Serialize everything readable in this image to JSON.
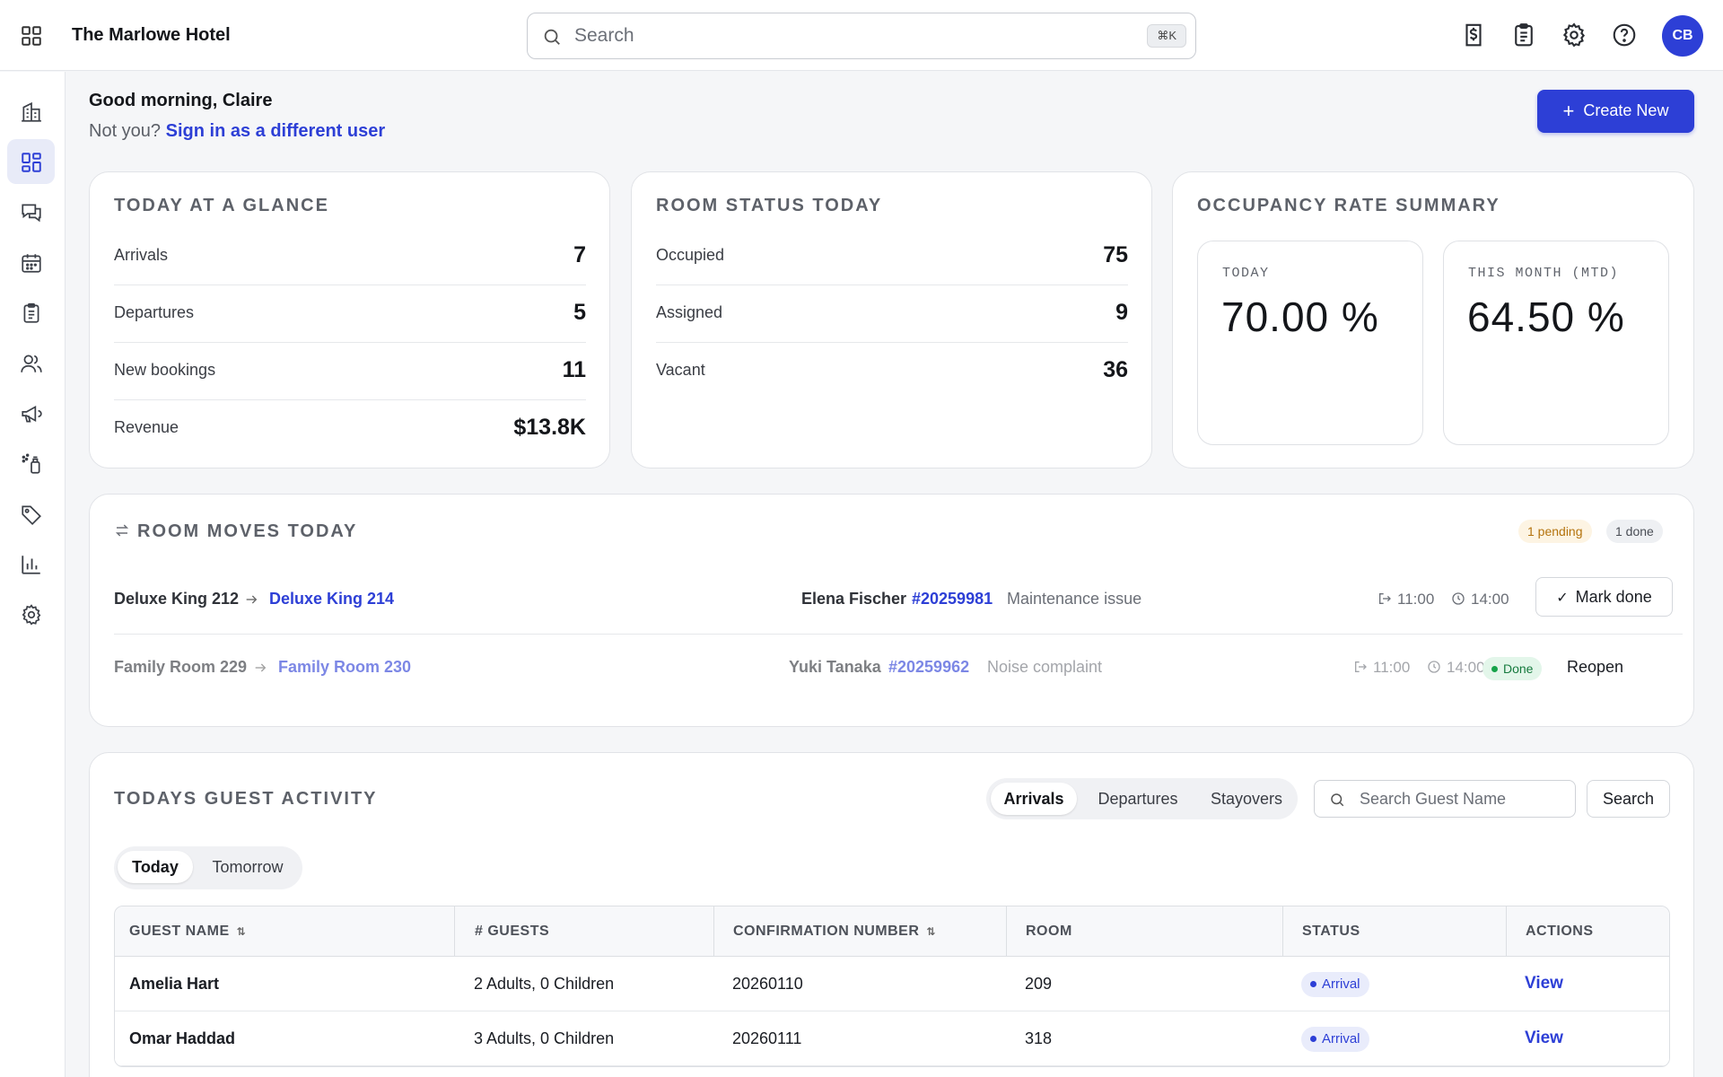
{
  "header": {
    "hotel_name": "The Marlowe Hotel",
    "search_placeholder": "Search",
    "search_shortcut": "⌘K",
    "avatar_initials": "CB",
    "tool_icons": [
      "billing-icon",
      "clipboard-icon",
      "gear-icon",
      "help-icon"
    ]
  },
  "sidebar": {
    "items": [
      {
        "icon": "building-icon",
        "active": false
      },
      {
        "icon": "dashboard-icon",
        "active": true
      },
      {
        "icon": "chat-icon",
        "active": false
      },
      {
        "icon": "calendar-icon",
        "active": false
      },
      {
        "icon": "clipboard-icon",
        "active": false
      },
      {
        "icon": "users-icon",
        "active": false
      },
      {
        "icon": "megaphone-icon",
        "active": false
      },
      {
        "icon": "cleaning-icon",
        "active": false
      },
      {
        "icon": "tag-icon",
        "active": false
      },
      {
        "icon": "bar-chart-icon",
        "active": false
      },
      {
        "icon": "gear-icon",
        "active": false
      }
    ]
  },
  "greeting": {
    "title": "Good morning, Claire",
    "not_you": "Not you?",
    "switch_link": "Sign in as a different user",
    "create_button": "Create New"
  },
  "glance": {
    "title": "TODAY AT A GLANCE",
    "rows": [
      {
        "label": "Arrivals",
        "value": "7"
      },
      {
        "label": "Departures",
        "value": "5"
      },
      {
        "label": "New bookings",
        "value": "11"
      },
      {
        "label": "Revenue",
        "value": "$13.8K"
      }
    ]
  },
  "room_status": {
    "title": "ROOM STATUS TODAY",
    "rows": [
      {
        "label": "Occupied",
        "value": "75"
      },
      {
        "label": "Assigned",
        "value": "9"
      },
      {
        "label": "Vacant",
        "value": "36"
      }
    ]
  },
  "occupancy": {
    "title": "OCCUPANCY RATE SUMMARY",
    "today_label": "TODAY",
    "today_value": "70.00 %",
    "month_label": "THIS MONTH (MTD)",
    "month_value": "64.50 %"
  },
  "room_moves": {
    "title": "ROOM MOVES TODAY",
    "pending_badge": "1 pending",
    "done_badge": "1 done",
    "moves": [
      {
        "from": "Deluxe King 212",
        "to": "Deluxe King 214",
        "guest": "Elena Fischer",
        "confirmation": "#20259981",
        "reason": "Maintenance issue",
        "checkout_time": "11:00",
        "checkin_time": "14:00",
        "action": "Mark done",
        "status": ""
      },
      {
        "from": "Family Room 229",
        "to": "Family Room 230",
        "guest": "Yuki Tanaka",
        "confirmation": "#20259962",
        "reason": "Noise complaint",
        "checkout_time": "11:00",
        "checkin_time": "14:00",
        "action": "Reopen",
        "status": "Done"
      }
    ]
  },
  "guest_activity": {
    "title": "TODAYS GUEST ACTIVITY",
    "tabs": [
      "Arrivals",
      "Departures",
      "Stayovers"
    ],
    "active_tab": "Arrivals",
    "search_placeholder": "Search Guest Name",
    "search_button": "Search",
    "day_tabs": [
      "Today",
      "Tomorrow"
    ],
    "active_day": "Today",
    "columns": [
      "GUEST NAME",
      "# GUESTS",
      "CONFIRMATION NUMBER",
      "ROOM",
      "STATUS",
      "ACTIONS"
    ],
    "rows": [
      {
        "name": "Amelia Hart",
        "guests": "2 Adults, 0 Children",
        "confirmation": "20260110",
        "room": "209",
        "status": "Arrival",
        "action": "View"
      },
      {
        "name": "Omar Haddad",
        "guests": "3 Adults, 0 Children",
        "confirmation": "20260111",
        "room": "318",
        "status": "Arrival",
        "action": "View"
      }
    ]
  },
  "colors": {
    "accent": "#2d3fd6",
    "pending": "#b4730d",
    "done": "#16a34a"
  }
}
